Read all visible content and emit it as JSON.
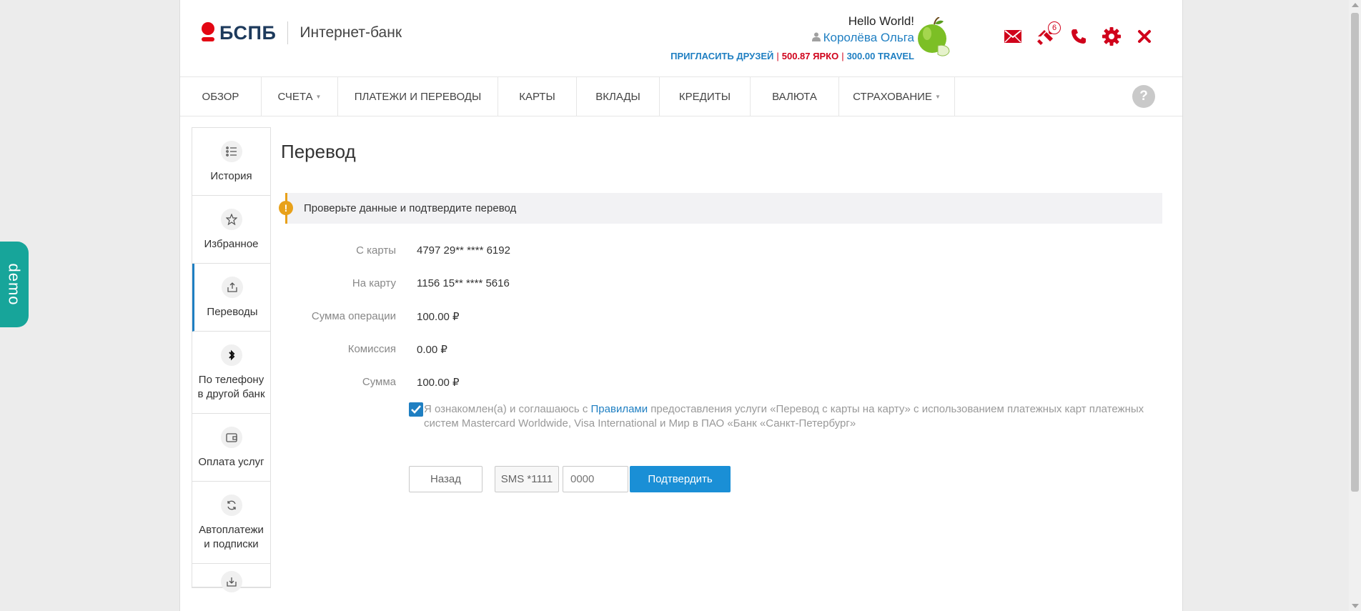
{
  "header": {
    "logo_text": "БСПБ",
    "logo_subtitle": "Интернет-банк",
    "greeting": "Hello World!",
    "user_name": "Королёва Ольга",
    "promo": {
      "invite": "ПРИГЛАСИТЬ ДРУЗЕЙ",
      "yarko": "500.87 ЯРКО",
      "travel": "300.00 TRAVEL"
    },
    "notifications_count": "6",
    "icons": [
      "mail-icon",
      "gift-icon",
      "phone-icon",
      "gear-icon",
      "close-icon"
    ],
    "accent_color": "#d0021b"
  },
  "nav": {
    "items": [
      {
        "label": "ОБЗОР",
        "caret": false
      },
      {
        "label": "СЧЕТА",
        "caret": true
      },
      {
        "label": "ПЛАТЕЖИ И ПЕРЕВОДЫ",
        "caret": false
      },
      {
        "label": "КАРТЫ",
        "caret": false
      },
      {
        "label": "ВКЛАДЫ",
        "caret": false
      },
      {
        "label": "КРЕДИТЫ",
        "caret": false
      },
      {
        "label": "ВАЛЮТА",
        "caret": false
      },
      {
        "label": "СТРАХОВАНИЕ",
        "caret": true
      }
    ],
    "help_label": "?"
  },
  "sidebar": {
    "items": [
      {
        "label": "История",
        "icon": "list-icon"
      },
      {
        "label": "Избранное",
        "icon": "star-icon"
      },
      {
        "label": "Переводы",
        "icon": "transfer-icon",
        "active": true
      },
      {
        "label": "По телефону в другой банк",
        "icon": "bluetooth-icon"
      },
      {
        "label": "Оплата услуг",
        "icon": "wallet-icon"
      },
      {
        "label": "Автоплатежи и подписки",
        "icon": "refresh-icon"
      }
    ]
  },
  "main": {
    "title": "Перевод",
    "alert": "Проверьте данные и подтвердите перевод",
    "details": [
      {
        "label": "С карты",
        "value": "4797 29** **** 6192"
      },
      {
        "label": "На карту",
        "value": "1156 15** **** 5616"
      },
      {
        "label": "Сумма операции",
        "value": "100.00 ₽"
      },
      {
        "label": "Комиссия",
        "value": "0.00 ₽"
      },
      {
        "label": "Сумма",
        "value": "100.00 ₽"
      }
    ],
    "agreement": {
      "checked": true,
      "prefix": "Я ознакомлен(а) и соглашаюсь с ",
      "link": "Правилами",
      "suffix": " предоставления услуги «Перевод с карты на карту» с использованием платежных карт платежных систем Mastercard Worldwide, Visa International и Мир в ПАО «Банк «Санкт-Петербург»"
    },
    "back_label": "Назад",
    "sms_prefix": "SMS *1111",
    "sms_placeholder": "0000",
    "confirm_label": "Подтвердить"
  },
  "demo_tab": "demo"
}
